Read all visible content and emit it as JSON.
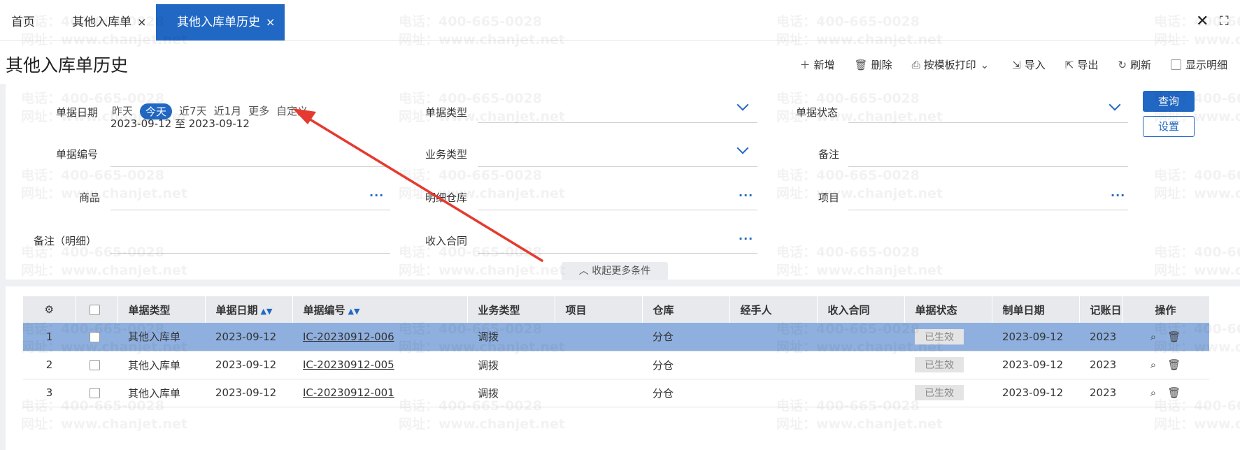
{
  "tabs": [
    {
      "label": "首页",
      "closable": false
    },
    {
      "label": "其他入库单",
      "closable": true
    },
    {
      "label": "其他入库单历史",
      "closable": true,
      "active": true
    }
  ],
  "close_glyph": "×",
  "window": {
    "close": "✕",
    "fullscreen": "⛶"
  },
  "page_title": "其他入库单历史",
  "toolbar": {
    "add": "新增",
    "delete": "删除",
    "print": "按模板打印",
    "import": "导入",
    "export": "导出",
    "refresh": "刷新",
    "show_detail": "显示明细"
  },
  "filters": {
    "doc_date_label": "单据日期",
    "date_options": [
      "昨天",
      "今天",
      "近7天",
      "近1月",
      "更多",
      "自定义"
    ],
    "date_range": "2023-09-12 至 2023-09-12",
    "doc_type_label": "单据类型",
    "doc_status_label": "单据状态",
    "doc_no_label": "单据编号",
    "biz_type_label": "业务类型",
    "remark_label": "备注",
    "goods_label": "商品",
    "detail_warehouse_label": "明细仓库",
    "project_label": "项目",
    "remark_detail_label": "备注（明细）",
    "income_contract_label": "收入合同",
    "more_dots": "···",
    "query": "查询",
    "settings": "设置",
    "collapse": "收起更多条件"
  },
  "table": {
    "headers": [
      "单据类型",
      "单据日期",
      "单据编号",
      "业务类型",
      "项目",
      "仓库",
      "经手人",
      "收入合同",
      "单据状态",
      "制单日期",
      "记账日",
      "操作"
    ],
    "rows": [
      {
        "no": "1",
        "doc_type": "其他入库单",
        "doc_date": "2023-09-12",
        "doc_no": "IC-20230912-006",
        "biz_type": "调拨",
        "project": "",
        "warehouse": "分仓",
        "handler": "",
        "contract": "",
        "status": "已生效",
        "create_date": "2023-09-12",
        "post_date": "2023"
      },
      {
        "no": "2",
        "doc_type": "其他入库单",
        "doc_date": "2023-09-12",
        "doc_no": "IC-20230912-005",
        "biz_type": "调拨",
        "project": "",
        "warehouse": "分仓",
        "handler": "",
        "contract": "",
        "status": "已生效",
        "create_date": "2023-09-12",
        "post_date": "2023"
      },
      {
        "no": "3",
        "doc_type": "其他入库单",
        "doc_date": "2023-09-12",
        "doc_no": "IC-20230912-001",
        "biz_type": "调拨",
        "project": "",
        "warehouse": "分仓",
        "handler": "",
        "contract": "",
        "status": "已生效",
        "create_date": "2023-09-12",
        "post_date": "2023"
      }
    ]
  },
  "watermark": {
    "line1": "电话：400-665-0028",
    "line2": "网址：www.chanjet.net"
  },
  "colors": {
    "accent": "#2168c4",
    "selected_row": "#8fb0df",
    "arrow": "#e53a2f"
  }
}
